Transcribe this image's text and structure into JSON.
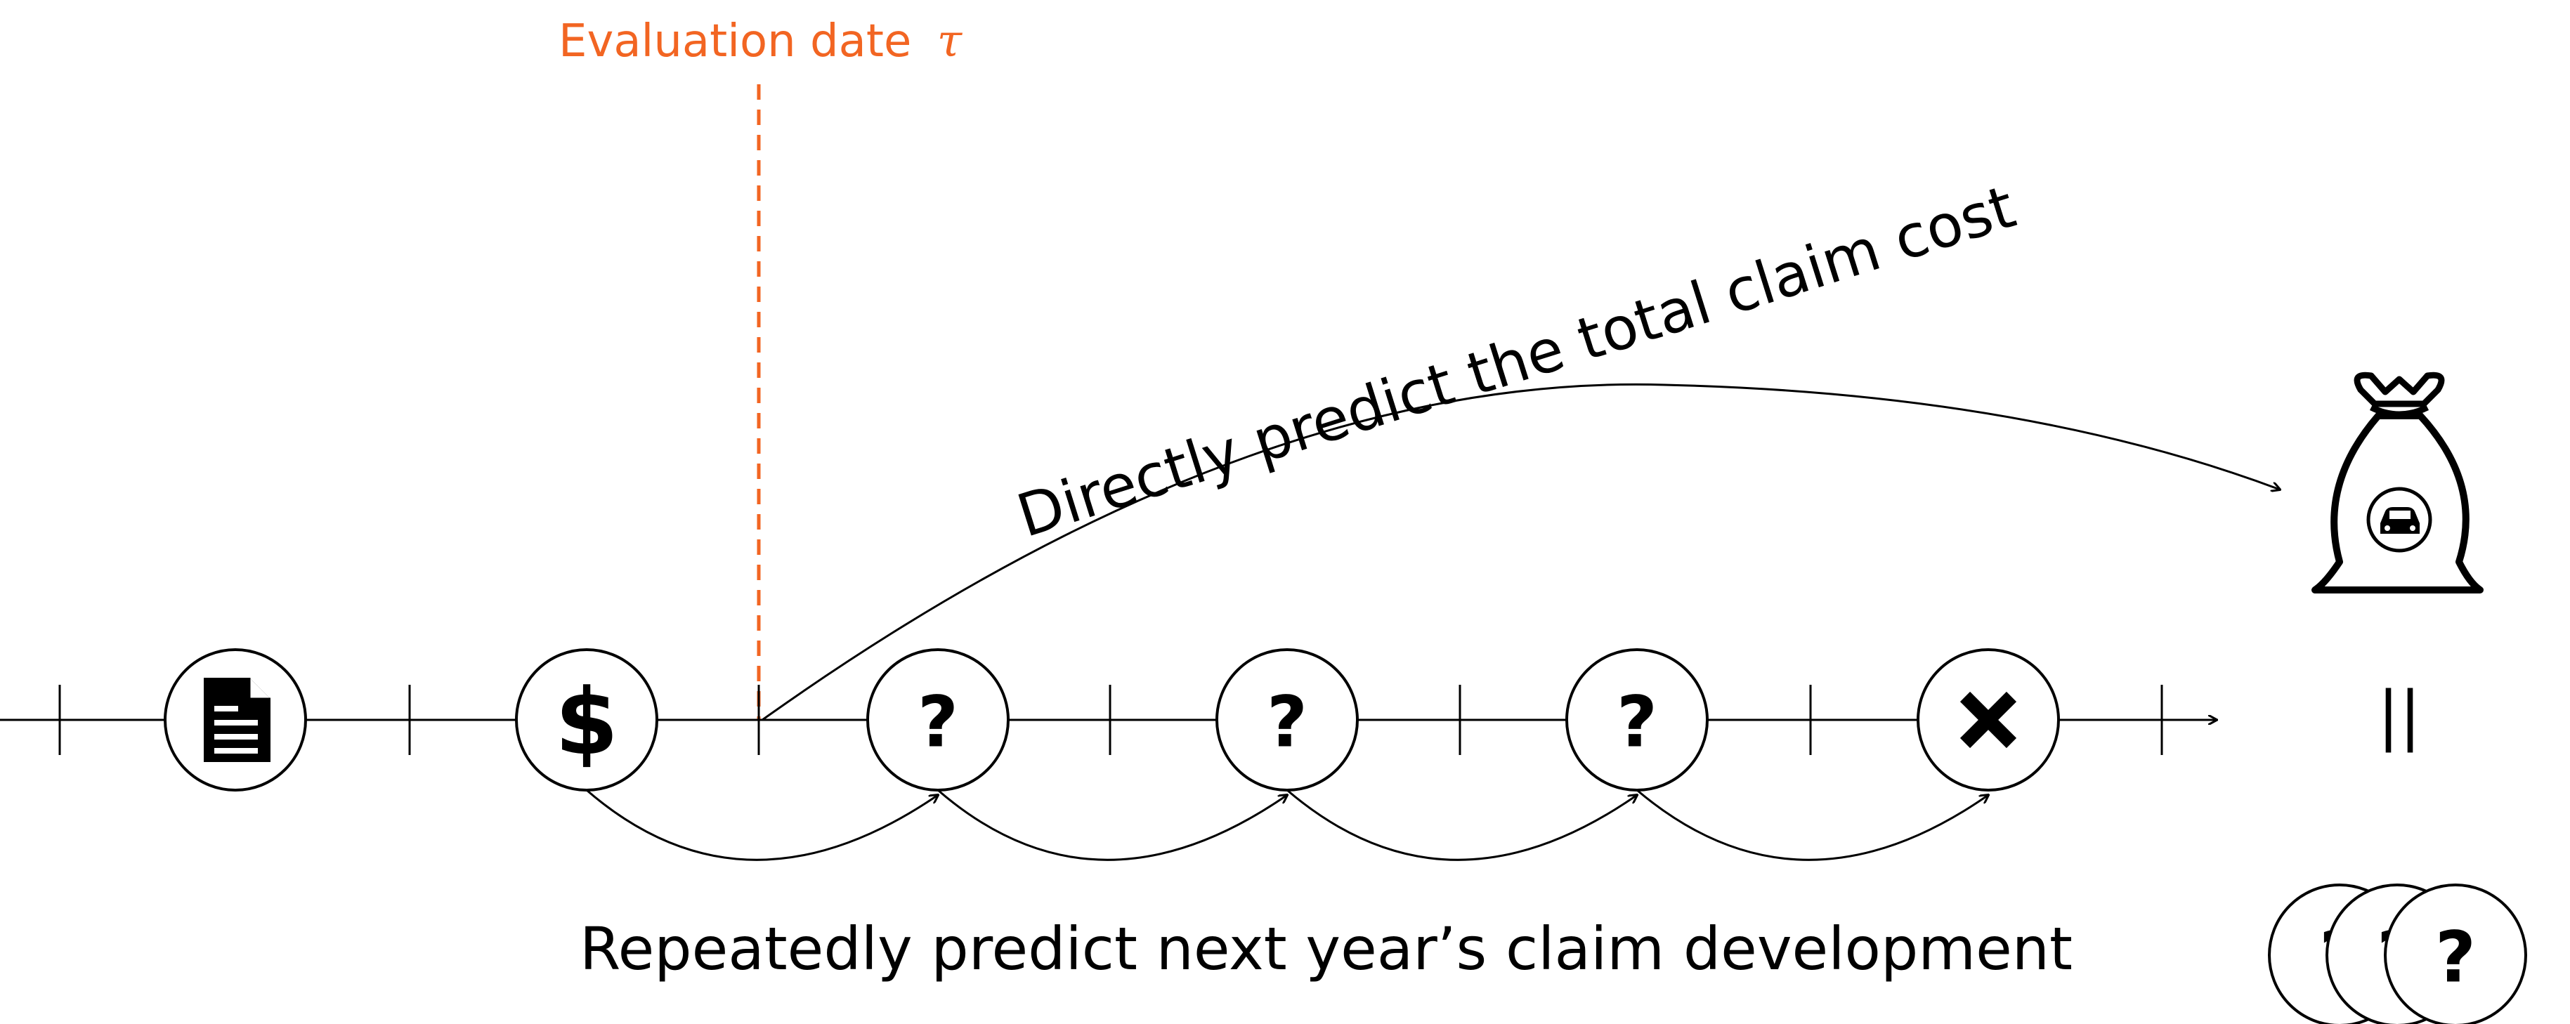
{
  "evaluation": {
    "label": "Evaluation date",
    "symbol": "τ",
    "color": "#f26522"
  },
  "timeline": {
    "nodes": [
      {
        "icon": "document-icon",
        "glyph": ""
      },
      {
        "icon": "dollar-icon",
        "glyph": "$"
      },
      {
        "icon": "question-icon",
        "glyph": "?"
      },
      {
        "icon": "question-icon",
        "glyph": "?"
      },
      {
        "icon": "question-icon",
        "glyph": "?"
      },
      {
        "icon": "close-icon",
        "glyph": "✕"
      }
    ]
  },
  "direct_prediction": {
    "label": "Directly predict the total claim cost"
  },
  "repeated_prediction": {
    "label": "Repeatedly predict next year’s claim development"
  },
  "total": {
    "equals_symbol": "||",
    "money_bag_icon": "money-bag-icon",
    "car_icon": "car-icon",
    "stack_glyph": "?"
  }
}
